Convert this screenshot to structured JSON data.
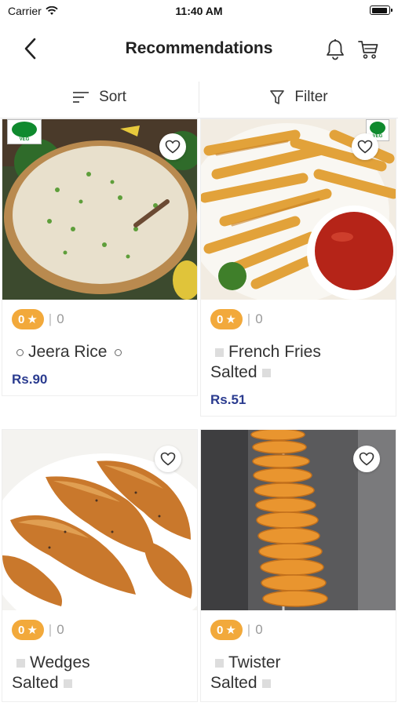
{
  "status": {
    "carrier": "Carrier",
    "time": "11:40 AM"
  },
  "header": {
    "title": "Recommendations"
  },
  "toolbar": {
    "sort_label": "Sort",
    "filter_label": "Filter"
  },
  "products": [
    {
      "rating": "0",
      "reviews": "0",
      "name_line1": "Jeera Rice",
      "name_line2": "",
      "price": "Rs.90",
      "badge": "VEG"
    },
    {
      "rating": "0",
      "reviews": "0",
      "name_line1": "French Fries",
      "name_line2": "Salted",
      "price": "Rs.51",
      "badge": "VEG"
    },
    {
      "rating": "0",
      "reviews": "0",
      "name_line1": "Wedges",
      "name_line2": "Salted",
      "price": "",
      "badge": ""
    },
    {
      "rating": "0",
      "reviews": "0",
      "name_line1": "Twister",
      "name_line2": "Salted",
      "price": "",
      "badge": ""
    }
  ],
  "colors": {
    "rating_pill": "#f2a93b",
    "price": "#2a3b8f",
    "veg": "#0f8a2e"
  }
}
